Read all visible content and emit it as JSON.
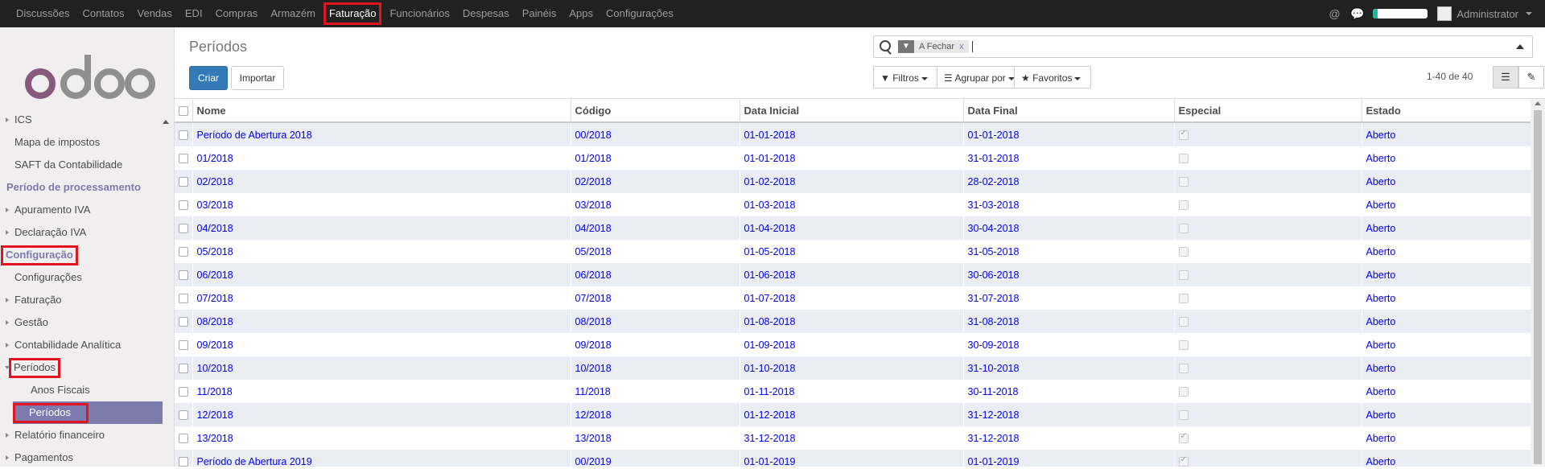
{
  "topbar": {
    "menu": [
      "Discussões",
      "Contatos",
      "Vendas",
      "EDI",
      "Compras",
      "Armazém",
      "Faturação",
      "Funcionários",
      "Despesas",
      "Painéis",
      "Apps",
      "Configurações"
    ],
    "active_index": 6,
    "user": "Administrator",
    "ticket_progress": 0.08,
    "icons": [
      "at-icon",
      "chat-icon"
    ]
  },
  "sidebar": {
    "items": [
      {
        "label": "ICS",
        "kind": "collapsible"
      },
      {
        "label": "Mapa de impostos",
        "kind": "leaf"
      },
      {
        "label": "SAFT da Contabilidade",
        "kind": "leaf"
      },
      {
        "label": "Período de processamento",
        "kind": "header"
      },
      {
        "label": "Apuramento IVA",
        "kind": "collapsible"
      },
      {
        "label": "Declaração IVA",
        "kind": "collapsible"
      },
      {
        "label": "Configuração",
        "kind": "header",
        "highlighted": true
      },
      {
        "label": "Configurações",
        "kind": "leaf"
      },
      {
        "label": "Faturação",
        "kind": "collapsible"
      },
      {
        "label": "Gestão",
        "kind": "collapsible"
      },
      {
        "label": "Contabilidade Analítica",
        "kind": "collapsible"
      },
      {
        "label": "Períodos",
        "kind": "expanded",
        "highlighted": true
      },
      {
        "label": "Anos Fiscais",
        "kind": "sub"
      },
      {
        "label": "Períodos",
        "kind": "selected",
        "highlighted": true
      },
      {
        "label": "Relatório financeiro",
        "kind": "collapsible"
      },
      {
        "label": "Pagamentos",
        "kind": "collapsible"
      }
    ]
  },
  "control": {
    "title": "Períodos",
    "create_label": "Criar",
    "import_label": "Importar",
    "facet_label": "A Fechar",
    "facet_remove": "x",
    "filters_label": "Filtros",
    "groupby_label": "Agrupar por",
    "favorites_label": "Favoritos",
    "pager": "1-40 de 40"
  },
  "table": {
    "columns": [
      "Nome",
      "Código",
      "Data Inicial",
      "Data Final",
      "Especial",
      "Estado"
    ],
    "rows": [
      {
        "nome": "Período de Abertura 2018",
        "codigo": "00/2018",
        "inicio": "01-01-2018",
        "fim": "01-01-2018",
        "especial": true,
        "estado": "Aberto"
      },
      {
        "nome": "01/2018",
        "codigo": "01/2018",
        "inicio": "01-01-2018",
        "fim": "31-01-2018",
        "especial": false,
        "estado": "Aberto"
      },
      {
        "nome": "02/2018",
        "codigo": "02/2018",
        "inicio": "01-02-2018",
        "fim": "28-02-2018",
        "especial": false,
        "estado": "Aberto"
      },
      {
        "nome": "03/2018",
        "codigo": "03/2018",
        "inicio": "01-03-2018",
        "fim": "31-03-2018",
        "especial": false,
        "estado": "Aberto"
      },
      {
        "nome": "04/2018",
        "codigo": "04/2018",
        "inicio": "01-04-2018",
        "fim": "30-04-2018",
        "especial": false,
        "estado": "Aberto"
      },
      {
        "nome": "05/2018",
        "codigo": "05/2018",
        "inicio": "01-05-2018",
        "fim": "31-05-2018",
        "especial": false,
        "estado": "Aberto"
      },
      {
        "nome": "06/2018",
        "codigo": "06/2018",
        "inicio": "01-06-2018",
        "fim": "30-06-2018",
        "especial": false,
        "estado": "Aberto"
      },
      {
        "nome": "07/2018",
        "codigo": "07/2018",
        "inicio": "01-07-2018",
        "fim": "31-07-2018",
        "especial": false,
        "estado": "Aberto"
      },
      {
        "nome": "08/2018",
        "codigo": "08/2018",
        "inicio": "01-08-2018",
        "fim": "31-08-2018",
        "especial": false,
        "estado": "Aberto"
      },
      {
        "nome": "09/2018",
        "codigo": "09/2018",
        "inicio": "01-09-2018",
        "fim": "30-09-2018",
        "especial": false,
        "estado": "Aberto"
      },
      {
        "nome": "10/2018",
        "codigo": "10/2018",
        "inicio": "01-10-2018",
        "fim": "31-10-2018",
        "especial": false,
        "estado": "Aberto"
      },
      {
        "nome": "11/2018",
        "codigo": "11/2018",
        "inicio": "01-11-2018",
        "fim": "30-11-2018",
        "especial": false,
        "estado": "Aberto"
      },
      {
        "nome": "12/2018",
        "codigo": "12/2018",
        "inicio": "01-12-2018",
        "fim": "31-12-2018",
        "especial": false,
        "estado": "Aberto"
      },
      {
        "nome": "13/2018",
        "codigo": "13/2018",
        "inicio": "31-12-2018",
        "fim": "31-12-2018",
        "especial": true,
        "estado": "Aberto"
      },
      {
        "nome": "Período de Abertura 2019",
        "codigo": "00/2019",
        "inicio": "01-01-2019",
        "fim": "01-01-2019",
        "especial": true,
        "estado": "Aberto"
      }
    ]
  }
}
